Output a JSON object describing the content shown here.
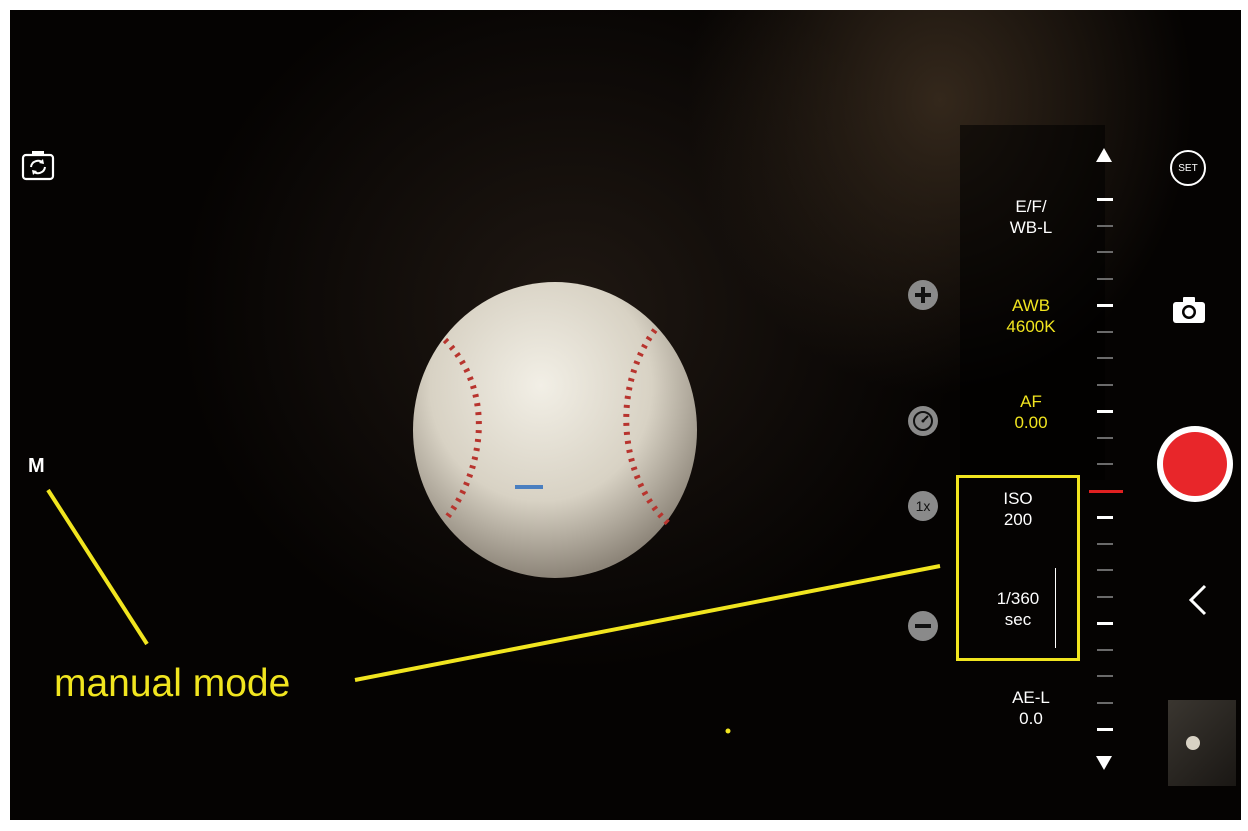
{
  "mode_indicator": "M",
  "annotation": {
    "label": "manual mode",
    "color": "#f1e51f"
  },
  "dial": {
    "items": [
      {
        "id": "efwb",
        "line1": "E/F/",
        "line2": "WB-L",
        "color": "#ffffff"
      },
      {
        "id": "awb",
        "line1": "AWB",
        "line2": "4600K",
        "color": "#f1e51f"
      },
      {
        "id": "af",
        "line1": "AF",
        "line2": "0.00",
        "color": "#f1e51f"
      },
      {
        "id": "iso",
        "line1": "ISO",
        "line2": "200",
        "color": "#ffffff"
      },
      {
        "id": "shutter",
        "line1": "1/360",
        "line2": "sec",
        "color": "#ffffff"
      },
      {
        "id": "ael",
        "line1": "AE-L",
        "line2": "0.0",
        "color": "#ffffff"
      }
    ]
  },
  "side_controls": {
    "zoom_label": "1x",
    "plus_icon": "plus-circle-icon",
    "minus_icon": "minus-circle-icon",
    "speed_icon": "speedometer-icon"
  },
  "right_bar": {
    "set_label": "SET",
    "photo_icon": "camera-icon",
    "record_color": "#e8262a",
    "back_icon": "chevron-left-icon",
    "thumbnail": "last-capture-thumbnail"
  },
  "top_left": {
    "switch_camera_icon": "switch-camera-icon"
  }
}
